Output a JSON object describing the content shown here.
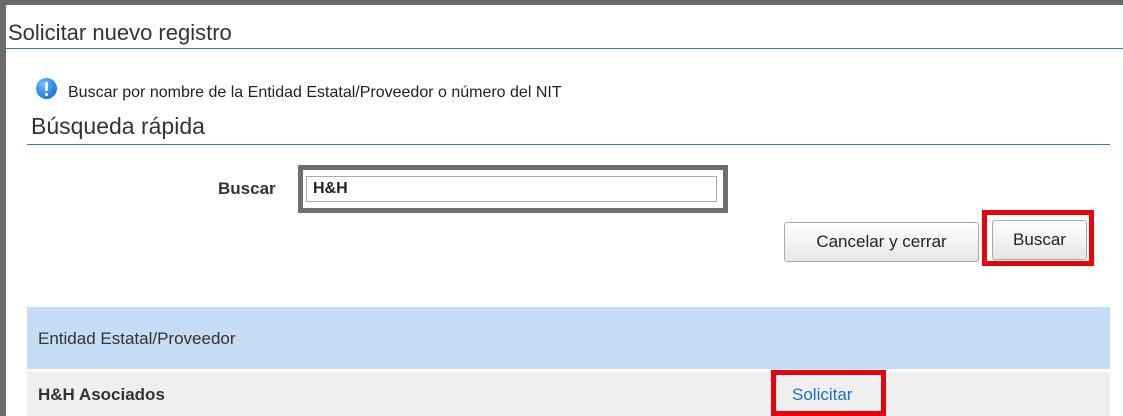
{
  "window": {
    "title": "Solicitar nuevo registro"
  },
  "info": {
    "icon": "info-icon",
    "text": "Buscar por nombre de la Entidad Estatal/Proveedor o número del NIT"
  },
  "quick_search": {
    "title": "Búsqueda rápida",
    "label": "Buscar",
    "value": "H&H"
  },
  "buttons": {
    "cancel": "Cancelar y cerrar",
    "search": "Buscar"
  },
  "table": {
    "header": "Entidad Estatal/Proveedor",
    "rows": [
      {
        "name": "H&H Asociados",
        "action": "Solicitar"
      }
    ]
  },
  "colors": {
    "accent": "#2d7fc0",
    "highlight_red": "#e8000b",
    "highlight_gray": "#6f6f6f",
    "header_bg": "#c4dcf4",
    "link": "#1a6fc9"
  }
}
